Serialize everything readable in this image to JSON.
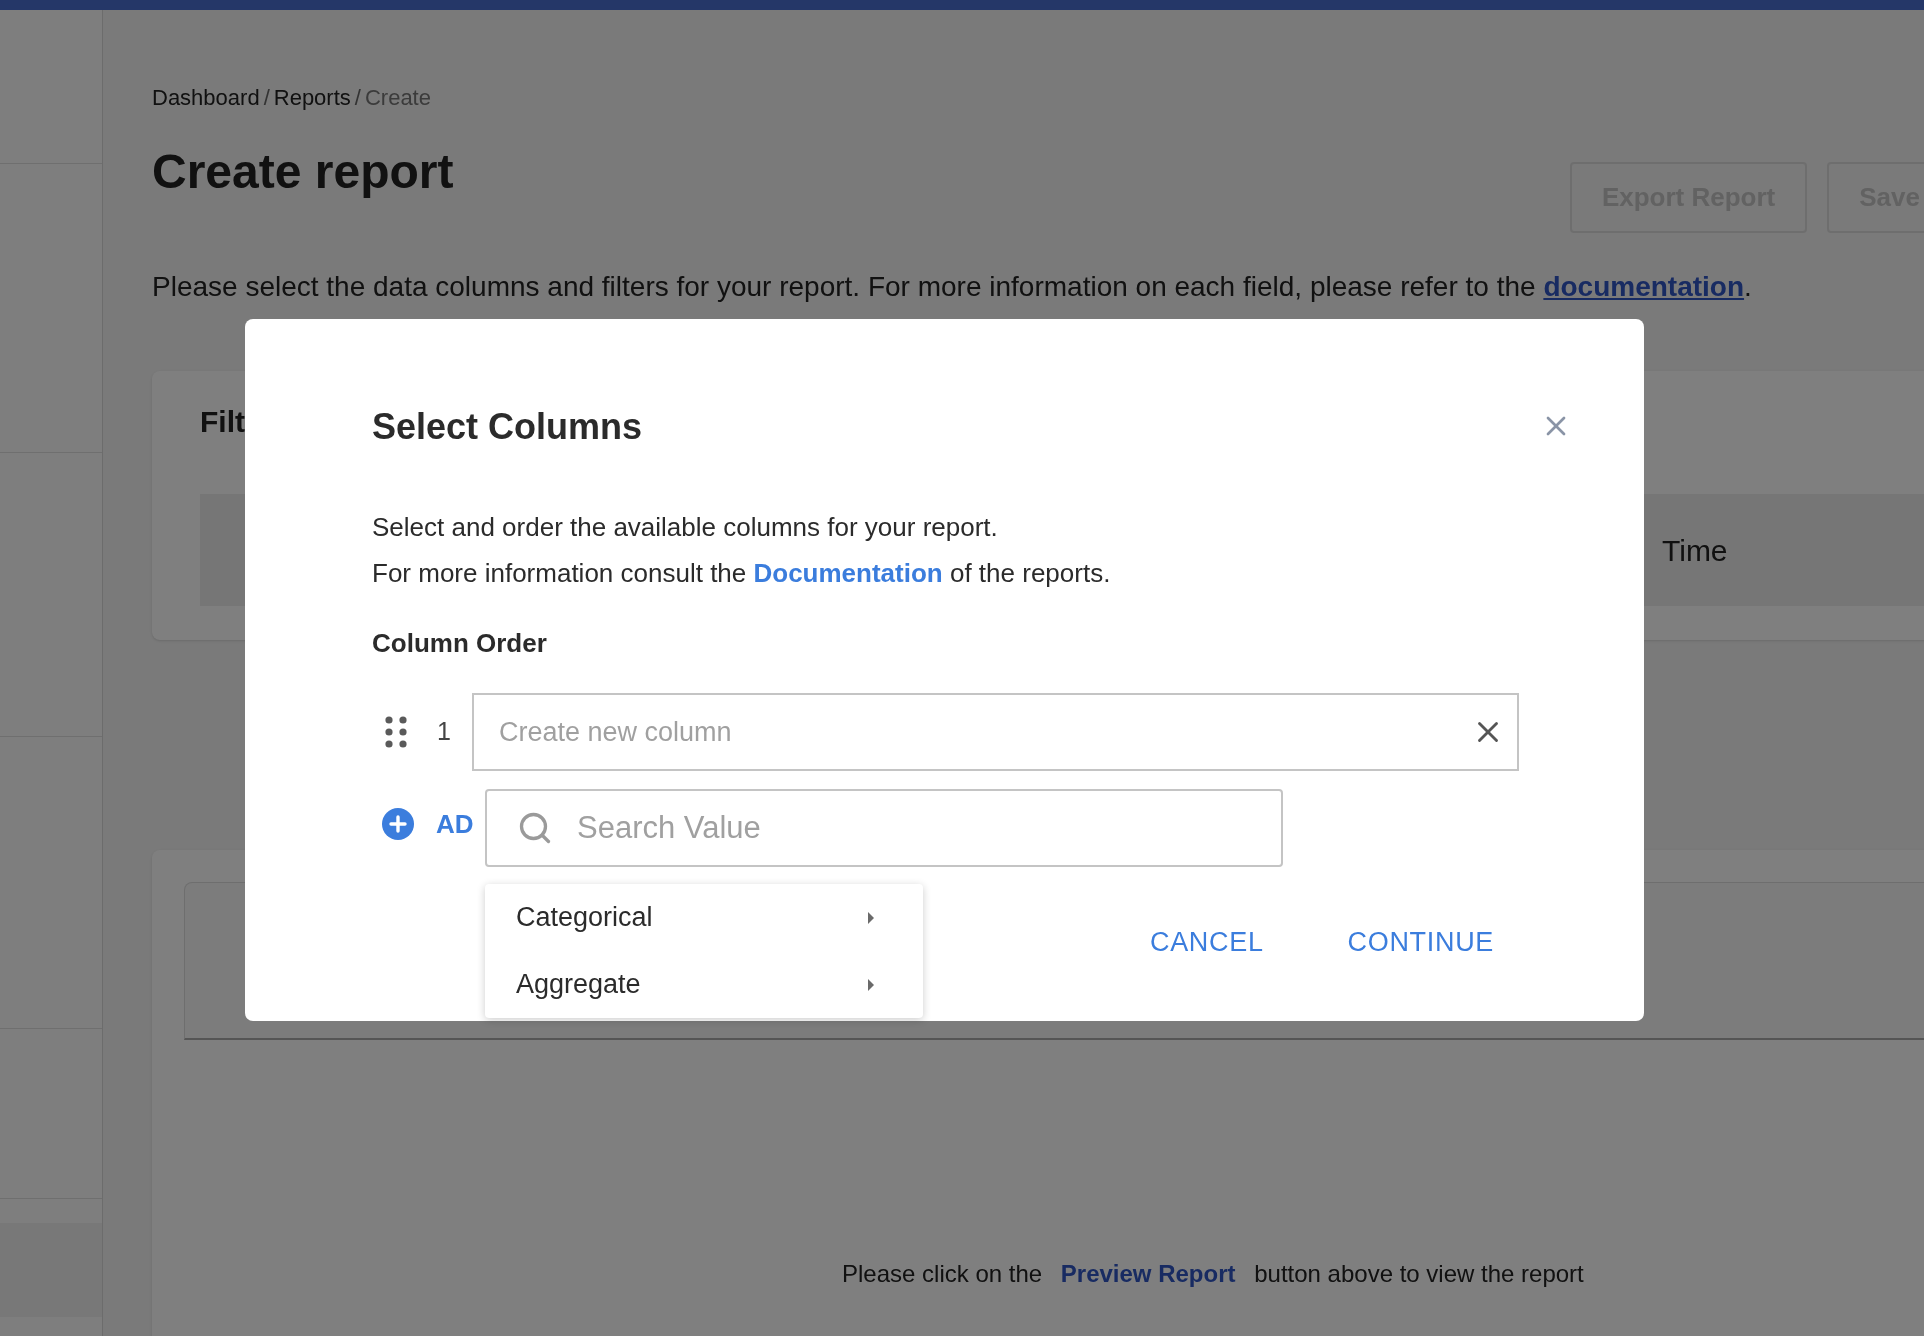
{
  "breadcrumb": [
    {
      "label": "Dashboard",
      "current": false
    },
    {
      "label": "Reports",
      "current": false,
      "separator": "/"
    },
    {
      "label": "Create",
      "current": true,
      "separator": "/"
    }
  ],
  "title": "Create report",
  "header_buttons": [
    {
      "label": "Export Report",
      "disabled": true
    },
    {
      "label": "Save",
      "disabled": true
    }
  ],
  "description": {
    "text": "Please select the data columns and filters for your report. For more information on each field, please refer to the ",
    "link": "documentation",
    "suffix": "."
  },
  "filter_card": {
    "title": "Filt",
    "column_header": "Time"
  },
  "preview_hint": {
    "before": "Please click on the",
    "link": "Preview Report",
    "after": "button above to view the report"
  },
  "modal": {
    "title": "Select Columns",
    "intro": "Select and order the available columns for your report.",
    "info": {
      "before": "For more information consult the ",
      "link": "Documentation",
      "after": " of the reports."
    },
    "section_title": "Column Order",
    "columns": [
      {
        "index": "1",
        "placeholder": "Create new column"
      }
    ],
    "add_label": "AD",
    "dropdown": {
      "search_placeholder": "Search Value",
      "options": [
        {
          "label": "Categorical"
        },
        {
          "label": "Aggregate"
        }
      ]
    },
    "actions": [
      "CANCEL",
      "CONTINUE"
    ]
  }
}
